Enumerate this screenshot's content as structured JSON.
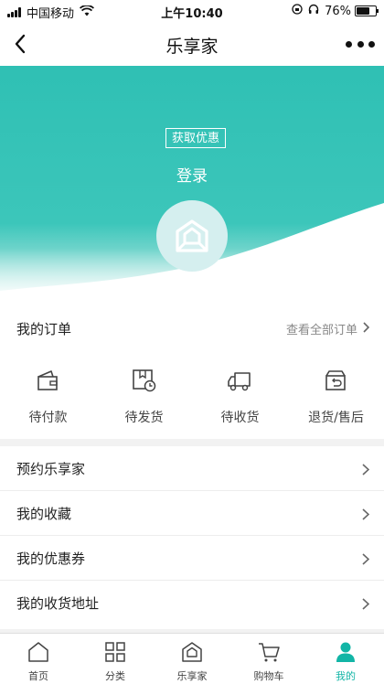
{
  "status_bar": {
    "carrier": "中国移动",
    "time": "上午10:40",
    "battery": "76%",
    "battery_level": 0.76
  },
  "nav": {
    "title": "乐享家",
    "back_icon": "back-chevron-icon",
    "more_icon": "more-dots-icon"
  },
  "hero": {
    "coupon_label": "获取优惠",
    "login_label": "登录",
    "accent_color": "#30c1b5"
  },
  "orders": {
    "title": "我的订单",
    "view_all": "查看全部订单",
    "items": [
      {
        "label": "待付款",
        "icon": "wallet-icon"
      },
      {
        "label": "待发货",
        "icon": "package-clock-icon"
      },
      {
        "label": "待收货",
        "icon": "truck-icon"
      },
      {
        "label": "退货/售后",
        "icon": "return-box-icon"
      }
    ]
  },
  "menu": {
    "items": [
      {
        "label": "预约乐享家"
      },
      {
        "label": "我的收藏"
      },
      {
        "label": "我的优惠券"
      },
      {
        "label": "我的收货地址"
      }
    ]
  },
  "tabbar": {
    "active_color": "#12b5a6",
    "items": [
      {
        "label": "首页",
        "icon": "home-icon"
      },
      {
        "label": "分类",
        "icon": "grid-icon"
      },
      {
        "label": "乐享家",
        "icon": "house-brand-icon"
      },
      {
        "label": "购物车",
        "icon": "cart-icon"
      },
      {
        "label": "我的",
        "icon": "user-icon",
        "active": true
      }
    ]
  }
}
